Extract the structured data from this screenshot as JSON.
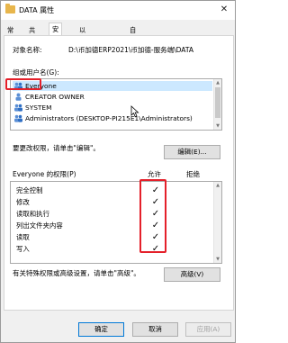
{
  "window": {
    "title": "DATA 属性",
    "close_glyph": "✕"
  },
  "tabs": [
    {
      "label": "常规",
      "active": false
    },
    {
      "label": "共享",
      "active": false
    },
    {
      "label": "安全",
      "active": true
    },
    {
      "label": "以前的版本",
      "active": false
    },
    {
      "label": "自定义",
      "active": false
    }
  ],
  "object": {
    "label": "对象名称:",
    "value": "D:\\币加德ERP2021\\币加德-服务端\\DATA"
  },
  "users": {
    "label": "组或用户名(G):",
    "items": [
      {
        "name": "Everyone",
        "icon": "group-icon",
        "selected": true
      },
      {
        "name": "CREATOR OWNER",
        "icon": "user-icon",
        "selected": false
      },
      {
        "name": "SYSTEM",
        "icon": "group-icon",
        "selected": false
      },
      {
        "name": "Administrators (DESKTOP-PI215E1\\Administrators)",
        "icon": "group-icon",
        "selected": false
      }
    ]
  },
  "change_hint": "要更改权限，请单击\"编辑\"。",
  "edit_button": "编辑(E)...",
  "permissions": {
    "header": "Everyone 的权限(P)",
    "allow_header": "允许",
    "deny_header": "拒绝",
    "items": [
      {
        "name": "完全控制",
        "allow": "✓",
        "deny": ""
      },
      {
        "name": "修改",
        "allow": "✓",
        "deny": ""
      },
      {
        "name": "读取和执行",
        "allow": "✓",
        "deny": ""
      },
      {
        "name": "列出文件夹内容",
        "allow": "✓",
        "deny": ""
      },
      {
        "name": "读取",
        "allow": "✓",
        "deny": ""
      },
      {
        "name": "写入",
        "allow": "✓",
        "deny": ""
      }
    ]
  },
  "advanced_hint": "有关特殊权限或高级设置，请单击\"高级\"。",
  "advanced_button": "高级(V)",
  "footer": {
    "ok": "确定",
    "cancel": "取消",
    "apply": "应用(A)"
  },
  "colors": {
    "selection": "#cce8ff",
    "highlight_box": "#e4202a",
    "primary_border": "#0078d7"
  }
}
